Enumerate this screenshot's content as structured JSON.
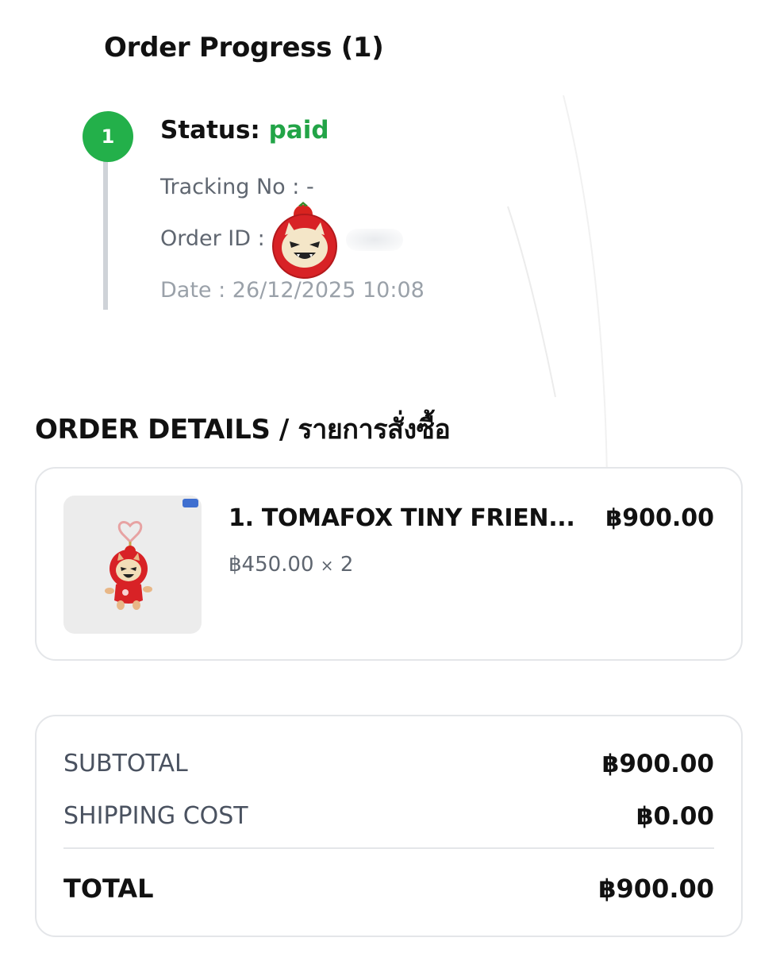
{
  "progress": {
    "title": "Order Progress (1)",
    "step_number": "1",
    "status_label": "Status:",
    "status_value": "paid",
    "tracking": "Tracking No : -",
    "order_id_label": "Order ID :",
    "date": "Date : 26/12/2025 10:08"
  },
  "details": {
    "heading": "ORDER DETAILS / รายการสั่งซื้อ",
    "items": [
      {
        "name": "1. TOMAFOX TINY FRIEN...",
        "line_total": "฿900.00",
        "unit_price": "฿450.00",
        "qty_sep": "×",
        "qty": "2"
      }
    ]
  },
  "summary": {
    "subtotal_label": "SUBTOTAL",
    "subtotal_value": "฿900.00",
    "shipping_label": "SHIPPING COST",
    "shipping_value": "฿0.00",
    "total_label": "TOTAL",
    "total_value": "฿900.00"
  },
  "colors": {
    "status_green": "#22a447",
    "step_circle": "#23b04a",
    "muted_text": "#5f6670",
    "date_text": "#9aa1a9",
    "card_border": "#e4e6e9"
  }
}
